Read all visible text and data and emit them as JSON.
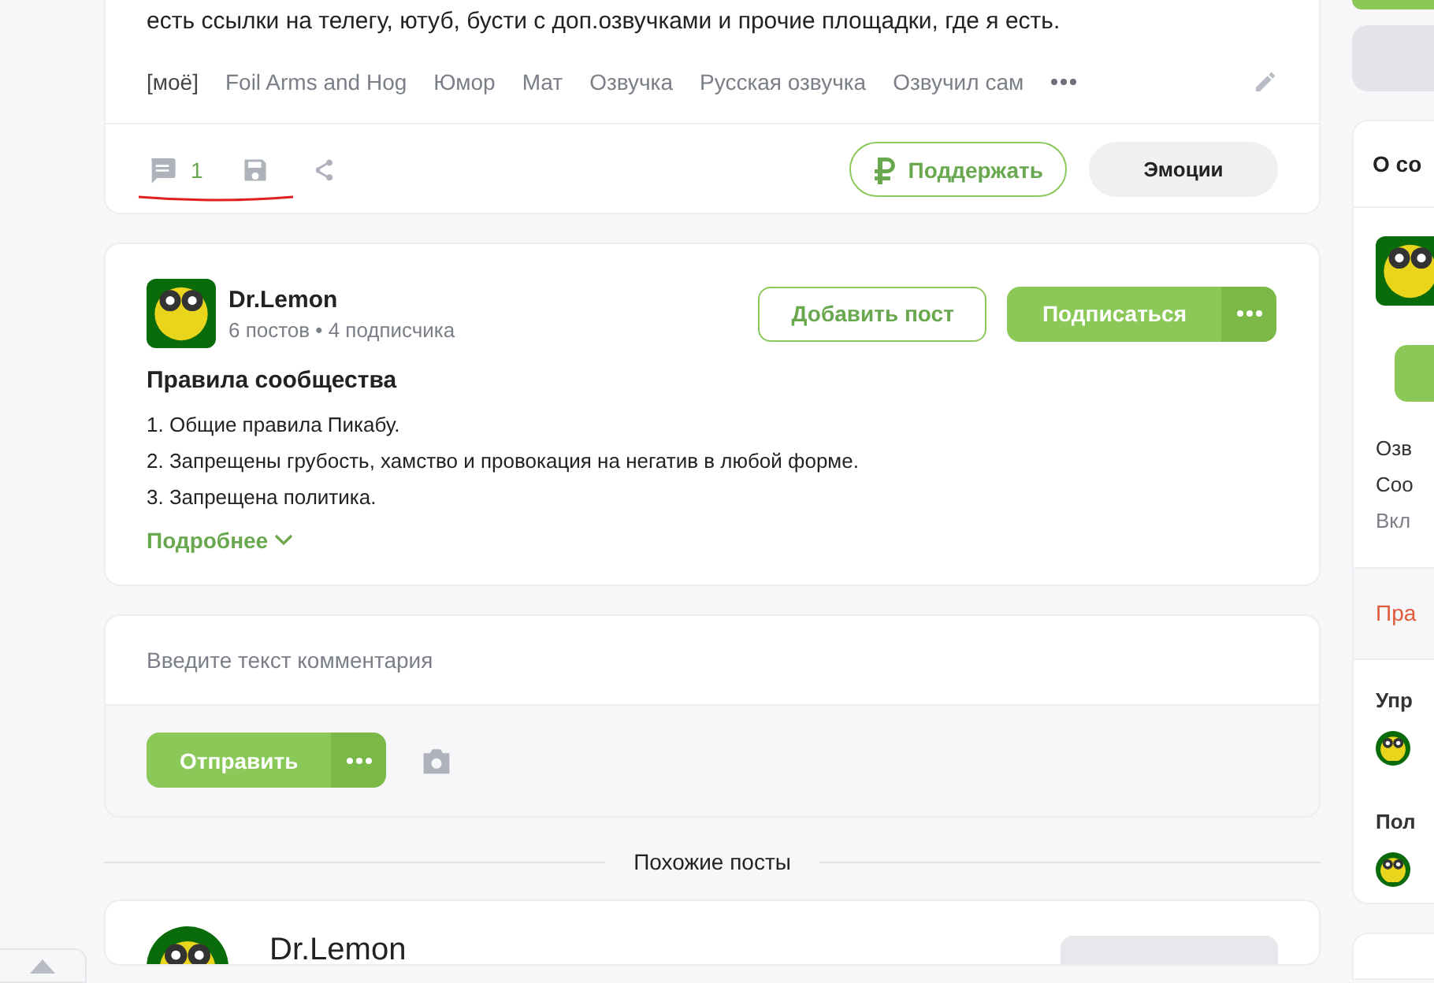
{
  "post": {
    "text": "есть ссылки на телегу, ютуб, бусти с доп.озвучками и прочие площадки, где я есть.",
    "tags": [
      "[моё]",
      "Foil Arms and Hog",
      "Юмор",
      "Мат",
      "Озвучка",
      "Русская озвучка",
      "Озвучил сам"
    ],
    "comments_count": "1",
    "support_button": "Поддержать",
    "emotions_button": "Эмоции"
  },
  "community": {
    "name": "Dr.Lemon",
    "stats": "6 постов • 4 подписчика",
    "add_post_button": "Добавить пост",
    "subscribe_button": "Подписаться",
    "rules_title": "Правила сообщества",
    "rules": [
      "1. Общие правила Пикабу.",
      "2. Запрещены грубость, хамство и провокация на негатив в любой форме.",
      "3. Запрещена политика."
    ],
    "more_link": "Подробнее"
  },
  "comment_form": {
    "placeholder": "Введите текст комментария",
    "send_button": "Отправить"
  },
  "similar_heading": "Похожие посты",
  "similar_post": {
    "author": "Dr.Lemon"
  },
  "sidebar": {
    "heading": "О со",
    "lines": [
      {
        "text": "Озв",
        "muted": false
      },
      {
        "text": "Соо",
        "muted": false
      },
      {
        "text": "Вкл",
        "muted": true
      }
    ],
    "rules_link": "Пра",
    "sections": [
      "Упр",
      "Пол"
    ]
  }
}
